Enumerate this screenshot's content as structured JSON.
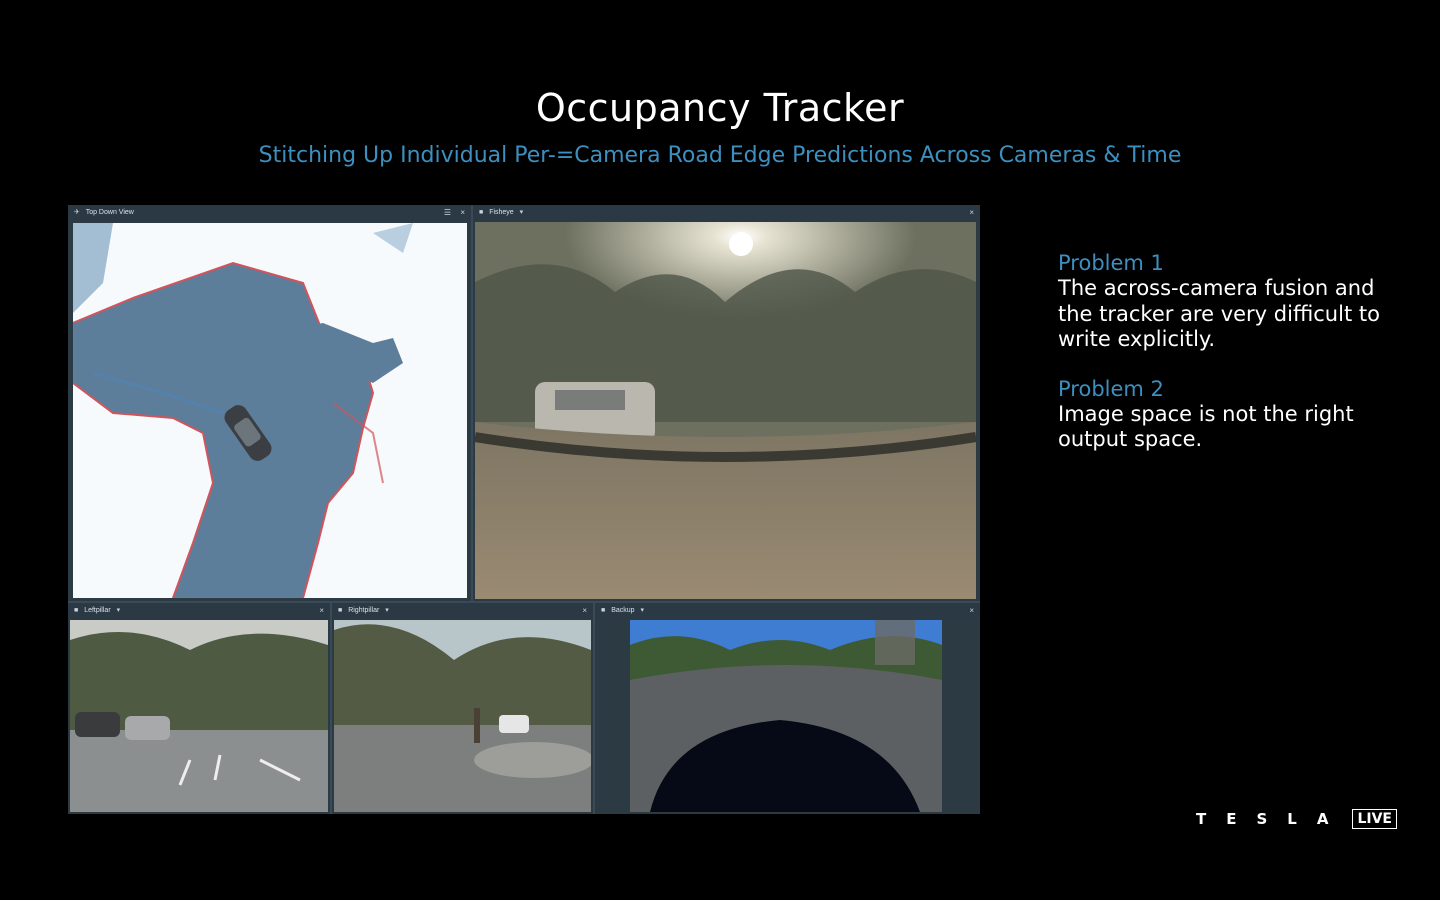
{
  "slide": {
    "title": "Occupancy Tracker",
    "subtitle": "Stitching Up Individual Per-=Camera Road Edge Predictions Across Cameras & Time"
  },
  "panels": {
    "top_down": {
      "label": "Top Down View",
      "close": "×"
    },
    "fisheye": {
      "label": "Fisheye",
      "close": "×"
    },
    "leftpillar": {
      "label": "Leftpillar",
      "close": "×"
    },
    "rightpillar": {
      "label": "Rightpillar",
      "close": "×"
    },
    "backup": {
      "label": "Backup",
      "close": "×"
    }
  },
  "problems": [
    {
      "title": "Problem 1",
      "text": "The across-camera fusion and the tracker are very difficult to write explicitly."
    },
    {
      "title": "Problem 2",
      "text": "Image space is not the right output space."
    }
  ],
  "branding": {
    "wordmark": "TESLA",
    "live": "LIVE"
  },
  "colors": {
    "accent": "#3d8fbf",
    "occupancy": "#5d7e9b",
    "edge": "#d0545c"
  }
}
